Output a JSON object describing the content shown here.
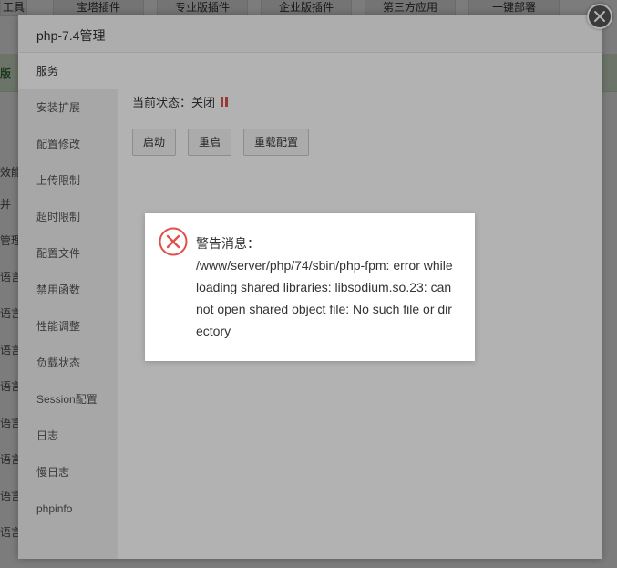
{
  "background": {
    "tabs": [
      "工具",
      "宝塔插件",
      "专业版插件",
      "企业版插件",
      "第三方应用",
      "一键部署"
    ],
    "banner_text": "版",
    "rows": [
      "效能",
      "并",
      "管理",
      "语言",
      "语言",
      "语言",
      "语言",
      "语言",
      "语言",
      "语言",
      "语言"
    ]
  },
  "dialog": {
    "title": "php-7.4管理",
    "close_icon": "close-x-icon"
  },
  "sidebar": {
    "items": [
      {
        "label": "服务",
        "active": true
      },
      {
        "label": "安装扩展"
      },
      {
        "label": "配置修改"
      },
      {
        "label": "上传限制"
      },
      {
        "label": "超时限制"
      },
      {
        "label": "配置文件"
      },
      {
        "label": "禁用函数"
      },
      {
        "label": "性能调整"
      },
      {
        "label": "负载状态"
      },
      {
        "label": "Session配置"
      },
      {
        "label": "日志"
      },
      {
        "label": "慢日志"
      },
      {
        "label": "phpinfo"
      }
    ]
  },
  "service": {
    "status_label": "当前状态：关闭",
    "status_icon": "pause-icon",
    "status_color": "#d9534f",
    "buttons": {
      "start": "启动",
      "restart": "重启",
      "reload": "重载配置"
    }
  },
  "alert": {
    "icon": "error-x-circle-icon",
    "icon_color": "#e2504c",
    "title": "警告消息：",
    "message": "/www/server/php/74/sbin/php-fpm: error while loading shared libraries: libsodium.so.23: cannot open shared object file: No such file or directory"
  }
}
